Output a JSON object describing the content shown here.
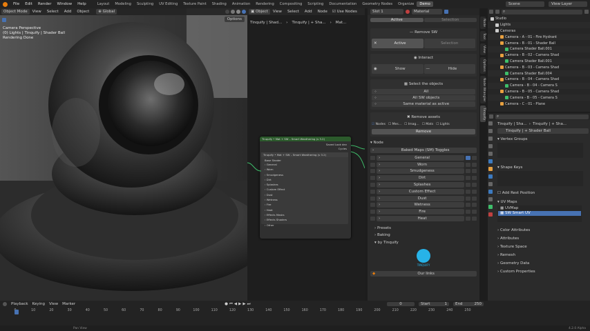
{
  "menus": [
    "File",
    "Edit",
    "Render",
    "Window",
    "Help"
  ],
  "workspaces": [
    "Layout",
    "Modeling",
    "Sculpting",
    "UV Editing",
    "Texture Paint",
    "Shading",
    "Animation",
    "Rendering",
    "Compositing",
    "Scripting",
    "Documentation",
    "Geometry Nodes",
    "Organize",
    "Demo"
  ],
  "active_workspace": "Demo",
  "scene": "Scene",
  "view_layer": "View Layer",
  "viewport": {
    "mode": "Object Mode",
    "menu": [
      "View",
      "Select",
      "Add",
      "Object"
    ],
    "orientation": "Global",
    "options": "Options",
    "overlay_lines": [
      "Camera Perspective",
      "(0) Lights | Tinquify | Shader Ball",
      "Rendering Done"
    ]
  },
  "node_editor": {
    "type": "Object",
    "menu": [
      "View",
      "Select",
      "Add",
      "Node"
    ],
    "use_nodes": "Use Nodes",
    "slot": "Slot 1",
    "material": "Material",
    "breadcrumbs": [
      "Tinquify | Shad...",
      "Tinquify | + Sha...",
      "Mat..."
    ],
    "group_node_title": "Tinquify • Mat + SW – Smart Weathering (v 3.2)",
    "group_outputs": [
      "Saved Look dev",
      "Cycles"
    ],
    "inner_node_title": "Tinquify • Mat + SW – Smart Weathering (v 3.2)",
    "inner_first": "Base Shader",
    "inner_items": [
      "General",
      "Worn",
      "Smudgeness",
      "Dirt",
      "Splashes",
      "Custom Effect",
      "Dust",
      "Wetness",
      "Fire",
      "Heat",
      "Effects Masks",
      "Effects Shaders",
      "Other"
    ]
  },
  "sidebar_panel": {
    "top_buttons": [
      "Active",
      "Selection"
    ],
    "remove_sw": "Remove SW",
    "remove_sw_buttons": [
      "Active",
      "Selection"
    ],
    "interact": "Interact",
    "interact_buttons": [
      "Show",
      "Hide"
    ],
    "select_objects": "Select the objects",
    "select_rows": [
      "All",
      "All SW objects",
      "Same material as active"
    ],
    "remove_assets": "Remove assets",
    "asset_checks": [
      "Nodes",
      "Mes...",
      "Imag...",
      "Mats",
      "Lights"
    ],
    "remove": "Remove",
    "node_section": "Node",
    "baked_maps": "Baked Maps (SM) Toggles",
    "toggles": [
      "General",
      "Worn",
      "Smudgeness",
      "Dirt",
      "Splashes",
      "Custom Effect",
      "Dust",
      "Wetness",
      "Fire",
      "Heat"
    ],
    "collapsed": [
      "Presets",
      "Baking",
      "by Tinquify"
    ],
    "logo_text": "TINQUIFY",
    "our_links": "Our links",
    "tabs": [
      "Node",
      "Tool",
      "View",
      "Options",
      "Node Wrangler",
      "Tinquify"
    ]
  },
  "outliner": {
    "search_placeholder": "",
    "items": [
      {
        "label": "Studio",
        "indent": 0
      },
      {
        "label": "Lights",
        "indent": 1
      },
      {
        "label": "Cameras",
        "indent": 1
      },
      {
        "label": "Camera - A - 01 - Fire Hydrant",
        "indent": 2
      },
      {
        "label": "Camera - B - 01 - Shader Ball",
        "indent": 2
      },
      {
        "label": "Camera Shader Ball.001",
        "indent": 3
      },
      {
        "label": "Camera - B - 02 - Camera Shad",
        "indent": 2
      },
      {
        "label": "Camera Shader Ball.001",
        "indent": 3
      },
      {
        "label": "Camera - B - 03 - Camera Shad",
        "indent": 2
      },
      {
        "label": "Camera Shader Ball.004",
        "indent": 3
      },
      {
        "label": "Camera - B - 04 - Camera Shad",
        "indent": 2
      },
      {
        "label": "Camera - B - 04 - Camera S",
        "indent": 3
      },
      {
        "label": "Camera - B - 05 - Camera Shad",
        "indent": 2
      },
      {
        "label": "Camera - B - 05 - Camera S",
        "indent": 3
      },
      {
        "label": "Camera - C - 01 - Plane",
        "indent": 2
      }
    ]
  },
  "properties": {
    "breadcrumb": [
      "Tinquify | Sha...",
      "Tinquify | + Sha..."
    ],
    "object_name": "Tinquify | + Shader Ball",
    "sections": [
      "Vertex Groups",
      "Shape Keys",
      "UV Maps",
      "Color Attributes",
      "Attributes",
      "Texture Space",
      "Remesh",
      "Geometry Data",
      "Custom Properties"
    ],
    "add_rest_position": "Add Rest Position",
    "uv_maps": [
      "UVMap",
      "SW Smart UV"
    ]
  },
  "timeline": {
    "menu": [
      "Playback",
      "Keying",
      "View",
      "Marker"
    ],
    "current_frame": "0",
    "start_label": "Start",
    "start": "1",
    "end_label": "End",
    "end": "250",
    "ticks": [
      "0",
      "10",
      "20",
      "30",
      "40",
      "50",
      "60",
      "70",
      "80",
      "90",
      "100",
      "110",
      "120",
      "130",
      "140",
      "150",
      "160",
      "170",
      "180",
      "190",
      "200",
      "210",
      "220",
      "230",
      "240",
      "250"
    ]
  },
  "status": {
    "left": "Pan View",
    "right": "4.2.0 Alpha"
  },
  "colors": {
    "accent_blue": "#4772b3",
    "node_header_green": "#2c5a2c",
    "socket_green": "#3ebe6a",
    "logo_cyan": "#27b3e8"
  }
}
